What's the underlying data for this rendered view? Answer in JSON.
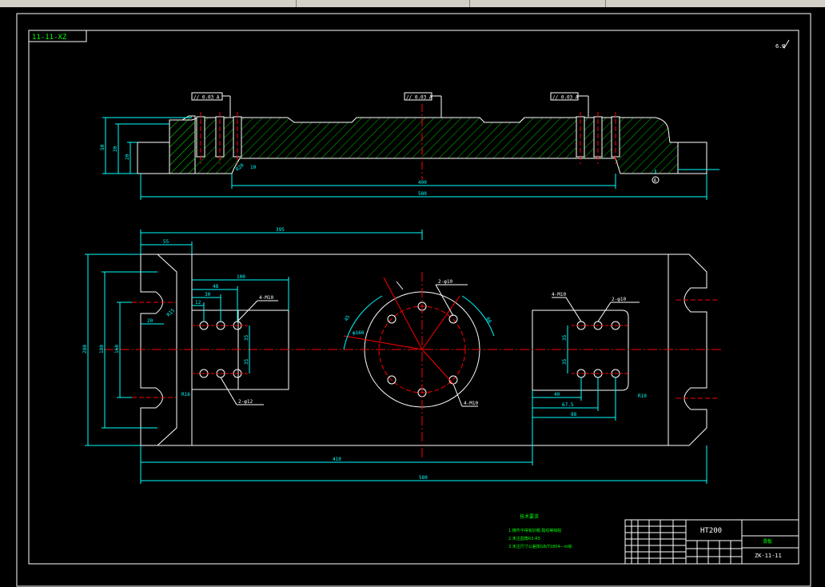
{
  "window": {
    "toolbar_fragments": [
      "",
      "",
      "",
      ""
    ]
  },
  "drawing": {
    "id_label": "11-11-XZ",
    "surface_mark": "6.3",
    "colors": {
      "background": "#000000",
      "outline": "#ffffff",
      "dimension": "#00ffff",
      "centerline": "#ff0000",
      "hatch": "#00ff00",
      "annotation": "#00ff00"
    },
    "section_view": {
      "tolerance_frames": [
        "// 0.03 A",
        "// 0.03 A",
        "// 0.03 A"
      ],
      "dims": {
        "h50": "50",
        "h30": "30",
        "h20": "20",
        "w400": "400",
        "w580": "580",
        "r10": "10",
        "r20": "R20"
      },
      "datum": "A"
    },
    "plan_view": {
      "dims": {
        "d395": "395",
        "d55": "55",
        "d48": "48",
        "d100": "100",
        "d30": "30",
        "d12": "12",
        "d20": "20",
        "d280": "280",
        "d180": "180",
        "d160": "160",
        "d35a": "35",
        "d35b": "35",
        "d35c": "35",
        "d35d": "35",
        "d40": "40",
        "d67_5": "67.5",
        "d88": "88",
        "d410": "410",
        "d580": "580",
        "d45": "45",
        "d60": "60",
        "r15": "R15",
        "r10": "R10",
        "r16": "R16"
      },
      "callouts": {
        "m10_left": "4-M10",
        "m10_right": "4-M10",
        "m10_circle": "4-M10",
        "holes_left": "2-φ12",
        "holes_right": "2-φ10",
        "holes_circle": "2-φ10",
        "bolt_circle": "φ160"
      }
    },
    "notes": {
      "heading": "技术要求",
      "lines": [
        "1.铸件不得有砂眼,裂纹等缺陷",
        "2.未注圆角R3-R5",
        "3.未注尺寸公差按GB/T1804—m级"
      ]
    },
    "title_block": {
      "material": "HT200",
      "part_name": "滑板",
      "drawing_no": "ZK-11-11"
    }
  }
}
